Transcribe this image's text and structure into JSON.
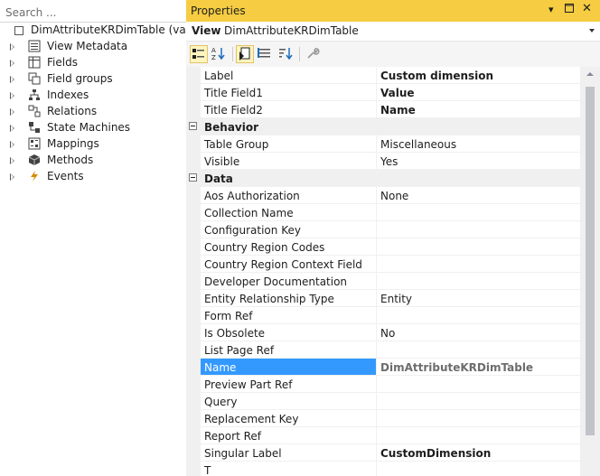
{
  "search": {
    "placeholder": "Search ..."
  },
  "tree": {
    "root_label": "DimAttributeKRDimTable (var) [R",
    "items": [
      {
        "label": "View Metadata",
        "icon": "view-metadata-icon"
      },
      {
        "label": "Fields",
        "icon": "fields-icon"
      },
      {
        "label": "Field groups",
        "icon": "field-groups-icon"
      },
      {
        "label": "Indexes",
        "icon": "indexes-icon"
      },
      {
        "label": "Relations",
        "icon": "relations-icon"
      },
      {
        "label": "State Machines",
        "icon": "state-machines-icon"
      },
      {
        "label": "Mappings",
        "icon": "mappings-icon"
      },
      {
        "label": "Methods",
        "icon": "methods-icon"
      },
      {
        "label": "Events",
        "icon": "events-icon"
      }
    ]
  },
  "properties": {
    "title": "Properties",
    "view_label": "View",
    "view_value": "DimAttributeKRDimTable",
    "rows_top": [
      {
        "name": "Label",
        "value": "Custom dimension",
        "bold": true
      },
      {
        "name": "Title Field1",
        "value": "Value",
        "bold": true
      },
      {
        "name": "Title Field2",
        "value": "Name",
        "bold": true
      }
    ],
    "categories": {
      "behavior": "Behavior",
      "data": "Data"
    },
    "rows_behavior": [
      {
        "name": "Table Group",
        "value": "Miscellaneous"
      },
      {
        "name": "Visible",
        "value": "Yes"
      }
    ],
    "rows_data": [
      {
        "name": "Aos Authorization",
        "value": "None"
      },
      {
        "name": "Collection Name",
        "value": ""
      },
      {
        "name": "Configuration Key",
        "value": ""
      },
      {
        "name": "Country Region Codes",
        "value": ""
      },
      {
        "name": "Country Region Context Field",
        "value": ""
      },
      {
        "name": "Developer Documentation",
        "value": ""
      },
      {
        "name": "Entity Relationship Type",
        "value": "Entity"
      },
      {
        "name": "Form Ref",
        "value": ""
      },
      {
        "name": "Is Obsolete",
        "value": "No"
      },
      {
        "name": "List Page Ref",
        "value": ""
      },
      {
        "name": "Name",
        "value": "DimAttributeKRDimTable",
        "selected": true
      },
      {
        "name": "Preview Part Ref",
        "value": ""
      },
      {
        "name": "Query",
        "value": ""
      },
      {
        "name": "Replacement Key",
        "value": ""
      },
      {
        "name": "Report Ref",
        "value": ""
      },
      {
        "name": "Singular Label",
        "value": "CustomDimension",
        "bold": true
      },
      {
        "name": "T",
        "value": ""
      }
    ]
  },
  "colors": {
    "title_bar": "#f5cc42",
    "selection": "#3399ff"
  }
}
